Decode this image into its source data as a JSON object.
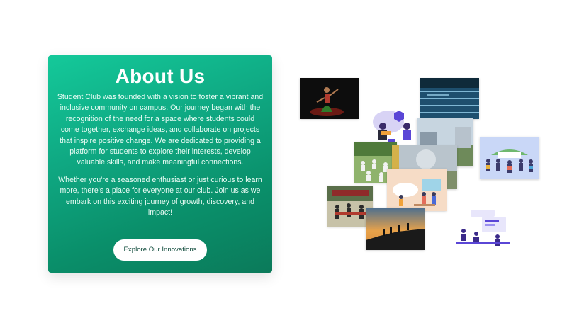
{
  "about": {
    "title": "About Us",
    "paragraph1": "Student Club was founded with a vision to foster a vibrant and inclusive community on campus. Our journey began with the recognition of the need for a space where students could come together, exchange ideas, and collaborate on projects that inspire positive change. We are dedicated to providing a platform for students to explore their interests, develop valuable skills, and make meaningful connections.",
    "paragraph2": "Whether you're a seasoned enthusiast or just curious to learn more, there's a place for everyone at our club. Join us as we embark on this exciting journey of growth, discovery, and impact!",
    "button_label": "Explore Our Innovations"
  },
  "colors": {
    "card_gradient_start": "#14c99a",
    "card_gradient_end": "#0b7a5a",
    "button_bg": "#ffffff",
    "button_text": "#0e4a3a"
  },
  "gallery": [
    {
      "name": "dance-photo"
    },
    {
      "name": "swimming-pool-photo"
    },
    {
      "name": "music-illustration"
    },
    {
      "name": "campus-photo"
    },
    {
      "name": "yoga-group-photo"
    },
    {
      "name": "outdoor-event-photo"
    },
    {
      "name": "celebration-illustration"
    },
    {
      "name": "collaboration-illustration"
    },
    {
      "name": "cultural-event-photo"
    },
    {
      "name": "sunset-hiking-photo"
    },
    {
      "name": "coding-illustration"
    }
  ]
}
